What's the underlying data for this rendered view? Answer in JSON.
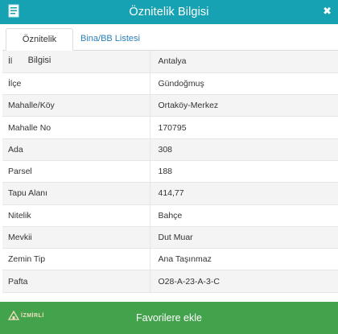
{
  "window": {
    "title": "Öznitelik Bilgisi",
    "close_glyph": "✖"
  },
  "tabs": [
    {
      "label": "Öznitelik Bilgisi",
      "active": true
    },
    {
      "label": "Bina/BB Listesi",
      "active": false
    }
  ],
  "attributes": [
    {
      "label": "İl",
      "value": "Antalya"
    },
    {
      "label": "İlçe",
      "value": "Gündoğmuş"
    },
    {
      "label": "Mahalle/Köy",
      "value": "Ortaköy-Merkez"
    },
    {
      "label": "Mahalle No",
      "value": "170795"
    },
    {
      "label": "Ada",
      "value": "308"
    },
    {
      "label": "Parsel",
      "value": "188"
    },
    {
      "label": "Tapu Alanı",
      "value": "414,77"
    },
    {
      "label": "Nitelik",
      "value": "Bahçe"
    },
    {
      "label": "Mevkii",
      "value": "Dut Muar"
    },
    {
      "label": "Zemin Tip",
      "value": "Ana Taşınmaz"
    },
    {
      "label": "Pafta",
      "value": "O28-A-23-A-3-C"
    }
  ],
  "footer": {
    "favorite_label": "Favorilere ekle",
    "logo_text": "İZMİRLİ"
  },
  "colors": {
    "header": "#17a2b4",
    "tab_link": "#2a7fb8",
    "button": "#43a24c"
  },
  "icons": {
    "window": "document-icon",
    "close": "close-icon"
  }
}
